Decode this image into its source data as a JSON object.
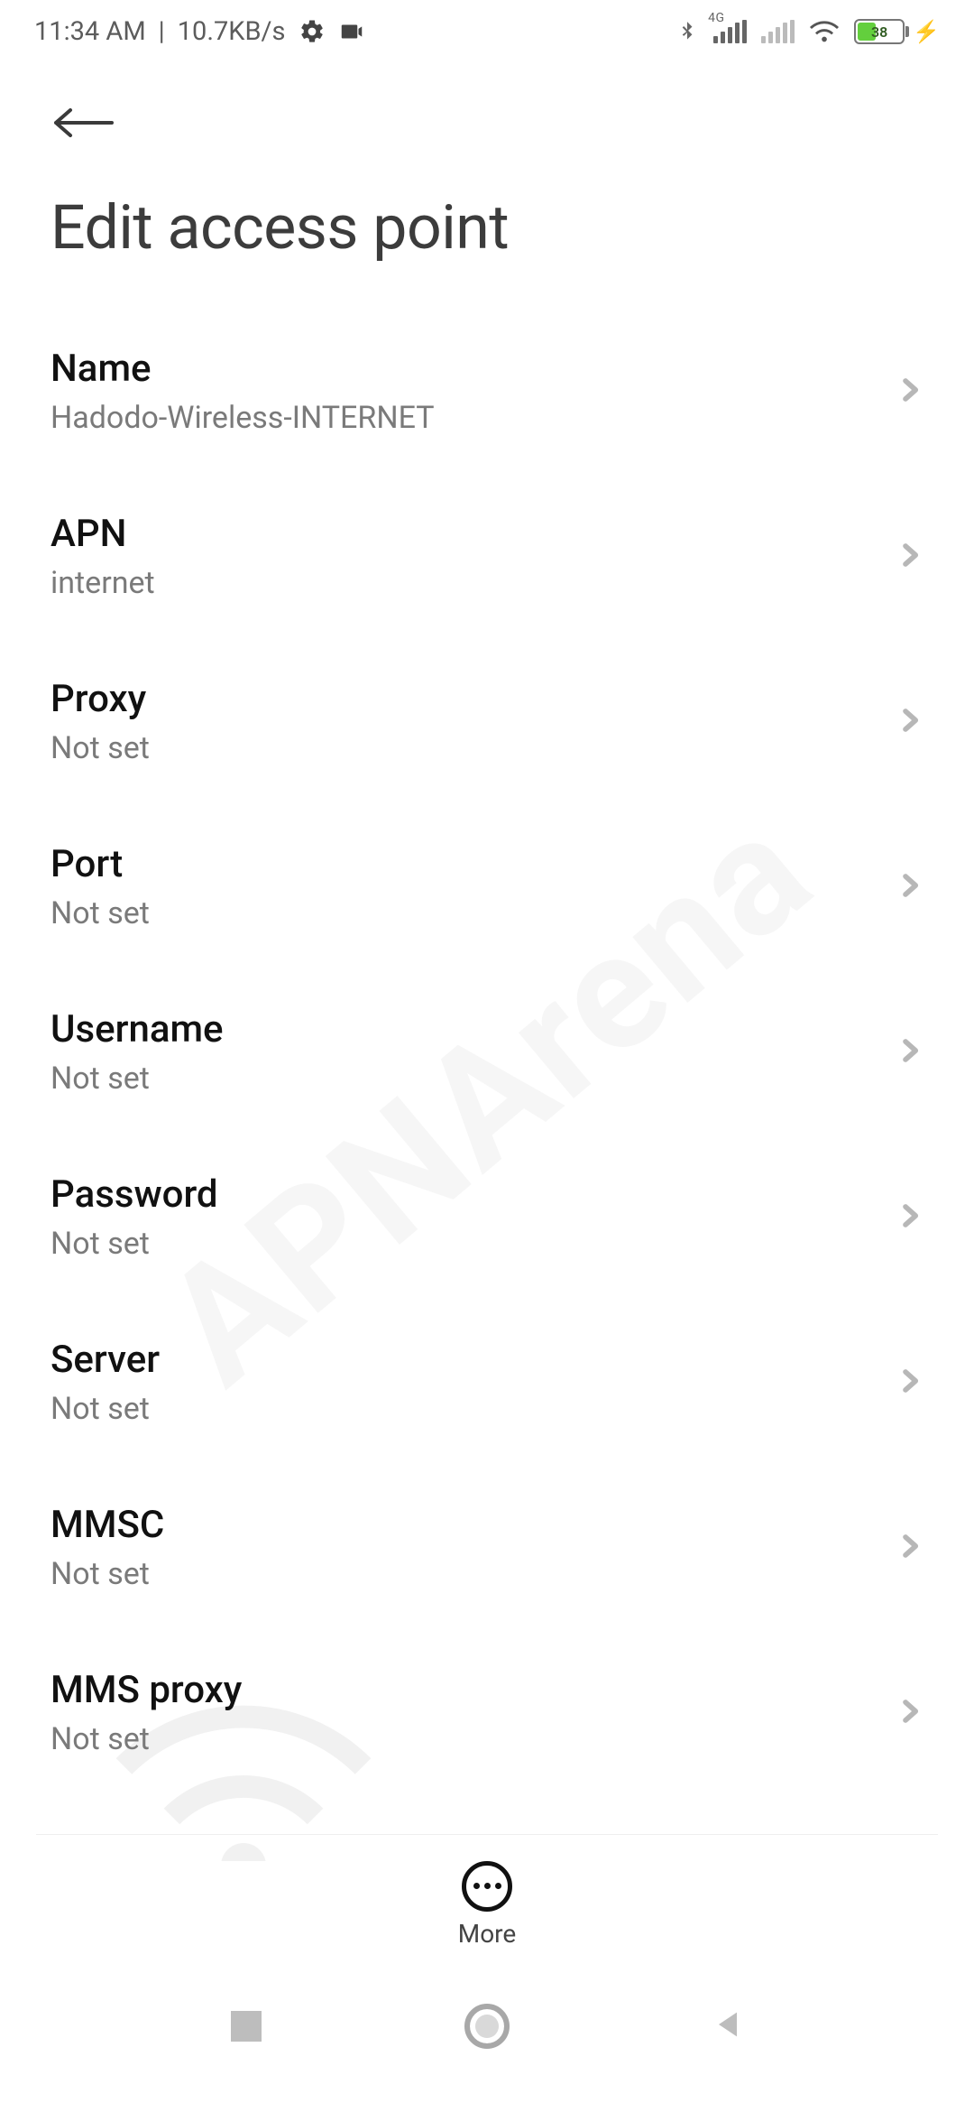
{
  "status": {
    "time": "11:34 AM",
    "separator": "|",
    "speed": "10.7KB/s",
    "network_label": "4G",
    "battery_percent": "38"
  },
  "page": {
    "title": "Edit access point"
  },
  "settings": [
    {
      "label": "Name",
      "value": "Hadodo-Wireless-INTERNET"
    },
    {
      "label": "APN",
      "value": "internet"
    },
    {
      "label": "Proxy",
      "value": "Not set"
    },
    {
      "label": "Port",
      "value": "Not set"
    },
    {
      "label": "Username",
      "value": "Not set"
    },
    {
      "label": "Password",
      "value": "Not set"
    },
    {
      "label": "Server",
      "value": "Not set"
    },
    {
      "label": "MMSC",
      "value": "Not set"
    },
    {
      "label": "MMS proxy",
      "value": "Not set"
    }
  ],
  "more": {
    "label": "More"
  },
  "watermark": "APNArena"
}
